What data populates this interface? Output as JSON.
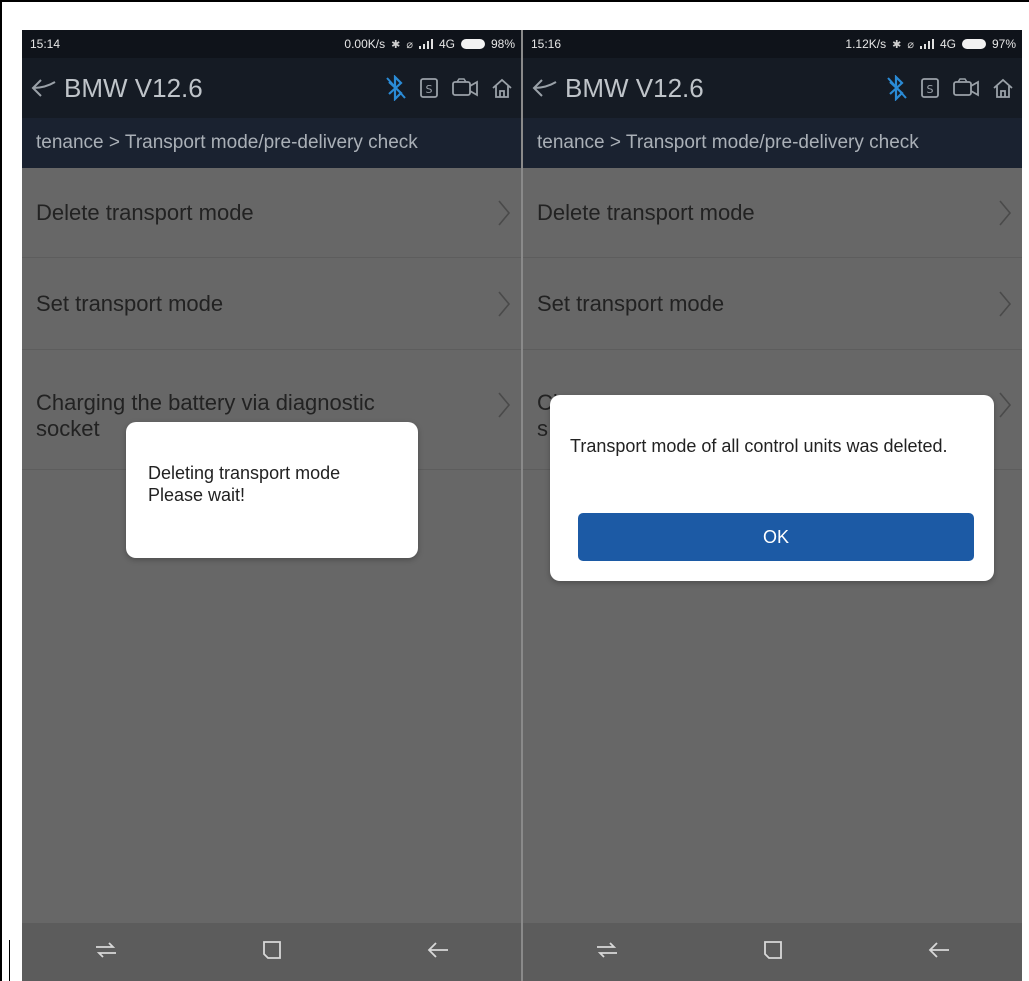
{
  "left_screen": {
    "status": {
      "time": "15:14",
      "speed": "0.00K/s",
      "network": "4G",
      "battery": "98%"
    },
    "title": "BMW V12.6",
    "breadcrumb": "tenance > Transport mode/pre-delivery check",
    "menu_items": [
      {
        "label": "Delete transport mode"
      },
      {
        "label": "Set transport mode"
      },
      {
        "label": "Charging the battery via diagnostic socket"
      }
    ],
    "dialog": {
      "line1": "Deleting transport mode",
      "line2": "Please wait!"
    }
  },
  "right_screen": {
    "status": {
      "time": "15:16",
      "speed": "1.12K/s",
      "network": "4G",
      "battery": "97%"
    },
    "title": "BMW V12.6",
    "breadcrumb": "tenance > Transport mode/pre-delivery check",
    "menu_items": [
      {
        "label": "Delete transport mode"
      },
      {
        "label": "Set transport mode"
      },
      {
        "label": "Ch"
      },
      {
        "label": "s"
      }
    ],
    "dialog": {
      "message": "Transport mode of all control units was deleted.",
      "ok_label": "OK"
    }
  },
  "colors": {
    "accent_bluetooth": "#2a8bd6",
    "ok_button": "#1c5aa5",
    "header": "#151b24",
    "overlay_gray": "#676767"
  },
  "icons": [
    "back-arrow-icon",
    "bluetooth-icon",
    "s-document-icon",
    "video-camera-icon",
    "home-icon",
    "chevron-right-icon",
    "nav-recent-icon",
    "nav-home-icon",
    "nav-back-icon"
  ]
}
